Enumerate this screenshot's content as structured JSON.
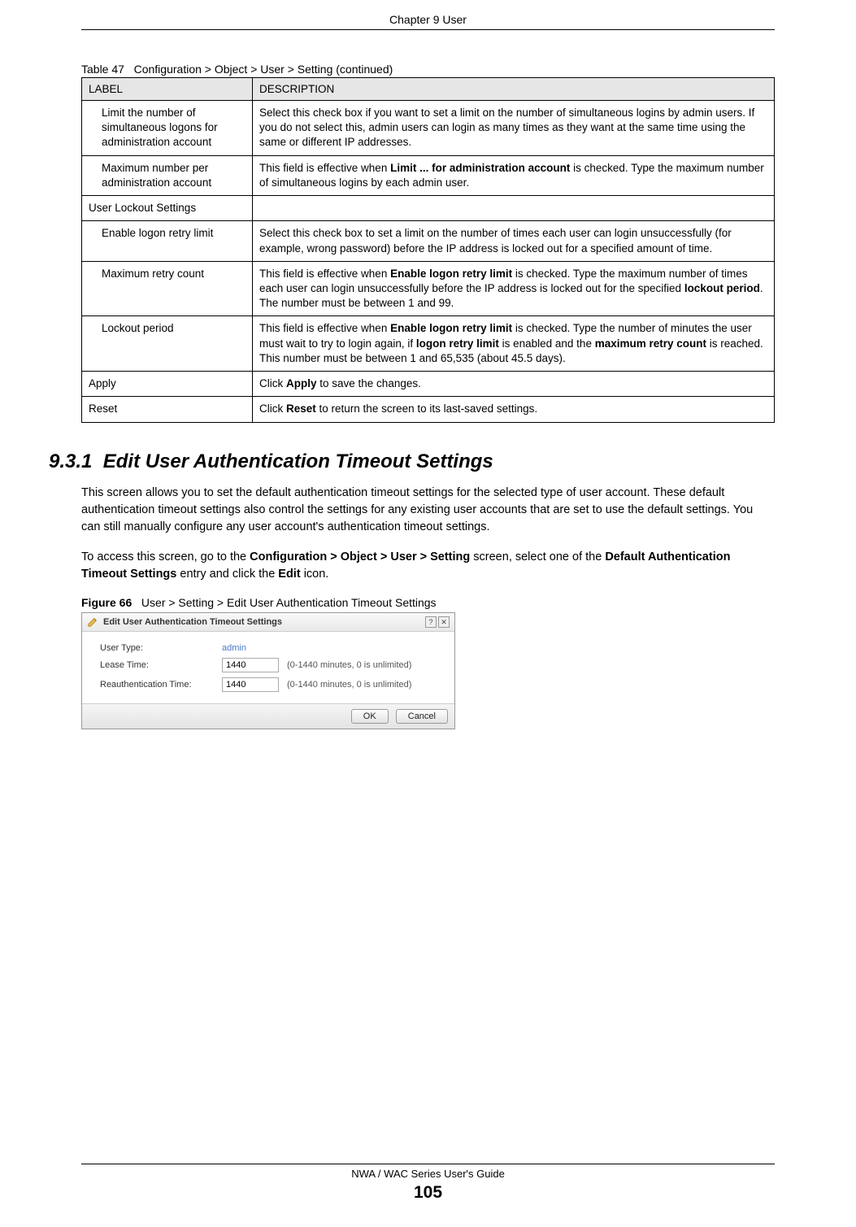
{
  "header": {
    "chapter": "Chapter 9 User"
  },
  "table": {
    "caption_prefix": "Table 47",
    "caption": "Configuration > Object > User > Setting (continued)",
    "headers": {
      "label": "LABEL",
      "description": "DESCRIPTION"
    },
    "rows": [
      {
        "label": "Limit the number of simultaneous logons for administration account",
        "indent": true,
        "desc": "Select this check box if you want to set a limit on the number of simultaneous logins by admin users. If you do not select this, admin users can login as many times as they want at the same time using the same or different IP addresses."
      },
      {
        "label": "Maximum number per administration account",
        "indent": true,
        "desc_parts": [
          {
            "t": "This field is effective when "
          },
          {
            "b": "Limit ... for administration account"
          },
          {
            "t": " is checked. Type the maximum number of simultaneous logins by each admin user."
          }
        ]
      },
      {
        "label": "User Lockout Settings",
        "indent": false,
        "blank": true
      },
      {
        "label": "Enable logon retry limit",
        "indent": true,
        "desc": "Select this check box to set a limit on the number of times each user can login unsuccessfully (for example, wrong password) before the IP address is locked out for a specified amount of time."
      },
      {
        "label": "Maximum retry count",
        "indent": true,
        "desc_parts": [
          {
            "t": "This field is effective when "
          },
          {
            "b": "Enable logon retry limit"
          },
          {
            "t": " is checked. Type the maximum number of times each user can login unsuccessfully before the IP address is locked out for the specified "
          },
          {
            "b": "lockout period"
          },
          {
            "t": ". The number must be between 1 and 99."
          }
        ]
      },
      {
        "label": "Lockout period",
        "indent": true,
        "desc_parts": [
          {
            "t": "This field is effective when "
          },
          {
            "b": "Enable logon retry limit"
          },
          {
            "t": " is checked. Type the number of minutes the user must wait to try to login again, if "
          },
          {
            "b": "logon retry limit"
          },
          {
            "t": " is enabled and the "
          },
          {
            "b": "maximum retry count"
          },
          {
            "t": " is reached. This number must be between 1 and 65,535 (about 45.5 days)."
          }
        ]
      },
      {
        "label": "Apply",
        "indent": false,
        "desc_parts": [
          {
            "t": "Click "
          },
          {
            "b": "Apply"
          },
          {
            "t": " to save the changes."
          }
        ]
      },
      {
        "label": "Reset",
        "indent": false,
        "desc_parts": [
          {
            "t": "Click "
          },
          {
            "b": "Reset"
          },
          {
            "t": " to return the screen to its last-saved settings."
          }
        ]
      }
    ]
  },
  "section": {
    "number": "9.3.1",
    "title": "Edit User Authentication Timeout Settings",
    "para1": "This screen allows you to set the default authentication timeout settings for the selected type of user account. These default authentication timeout settings also control the settings for any existing user accounts that are set to use the default settings. You can still manually configure any user account's authentication timeout settings.",
    "para2_parts": [
      {
        "t": "To access this screen, go to the "
      },
      {
        "b": "Configuration > Object > User > Setting"
      },
      {
        "t": " screen, select one of the "
      },
      {
        "b": "Default Authentication Timeout Settings"
      },
      {
        "t": " entry and click the "
      },
      {
        "b": "Edit"
      },
      {
        "t": " icon."
      }
    ]
  },
  "figure": {
    "caption_prefix": "Figure 66",
    "caption": "User > Setting > Edit User Authentication Timeout Settings",
    "dialog": {
      "title": "Edit User Authentication Timeout Settings",
      "fields": {
        "user_type_label": "User Type:",
        "user_type_value": "admin",
        "lease_time_label": "Lease Time:",
        "lease_time_value": "1440",
        "lease_time_hint": "(0-1440 minutes, 0 is unlimited)",
        "reauth_label": "Reauthentication Time:",
        "reauth_value": "1440",
        "reauth_hint": "(0-1440 minutes, 0 is unlimited)"
      },
      "buttons": {
        "ok": "OK",
        "cancel": "Cancel"
      }
    }
  },
  "footer": {
    "guide": "NWA / WAC Series User's Guide",
    "page": "105"
  }
}
